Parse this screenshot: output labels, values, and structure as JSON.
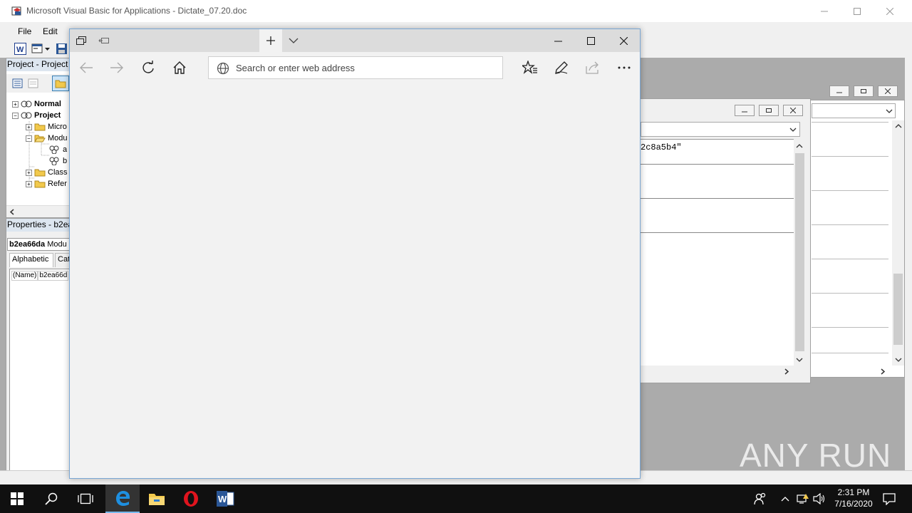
{
  "vba": {
    "title": "Microsoft Visual Basic for Applications - Dictate_07.20.doc",
    "menu": [
      "File",
      "Edit"
    ],
    "project_pane": {
      "title": "Project - Project",
      "tree": [
        {
          "label": "Normal",
          "bold": true
        },
        {
          "label": "Project",
          "bold": true
        },
        {
          "label": "Micro"
        },
        {
          "label": "Modu"
        },
        {
          "label": "a"
        },
        {
          "label": "b"
        },
        {
          "label": "Class"
        },
        {
          "label": "Refer"
        }
      ]
    },
    "properties_pane": {
      "title": "Properties - b2ea",
      "object_name": "b2ea66da",
      "object_type": "Modu",
      "tabs": [
        "Alphabetic",
        "Cate"
      ],
      "row_name": "(Name)",
      "row_value": "b2ea66d"
    },
    "code_window": {
      "code_line": "2c8a5b4\""
    }
  },
  "edge": {
    "address_placeholder": "Search or enter web address"
  },
  "watermark": "ANY RUN",
  "taskbar": {
    "time": "2:31 PM",
    "date": "7/16/2020"
  }
}
